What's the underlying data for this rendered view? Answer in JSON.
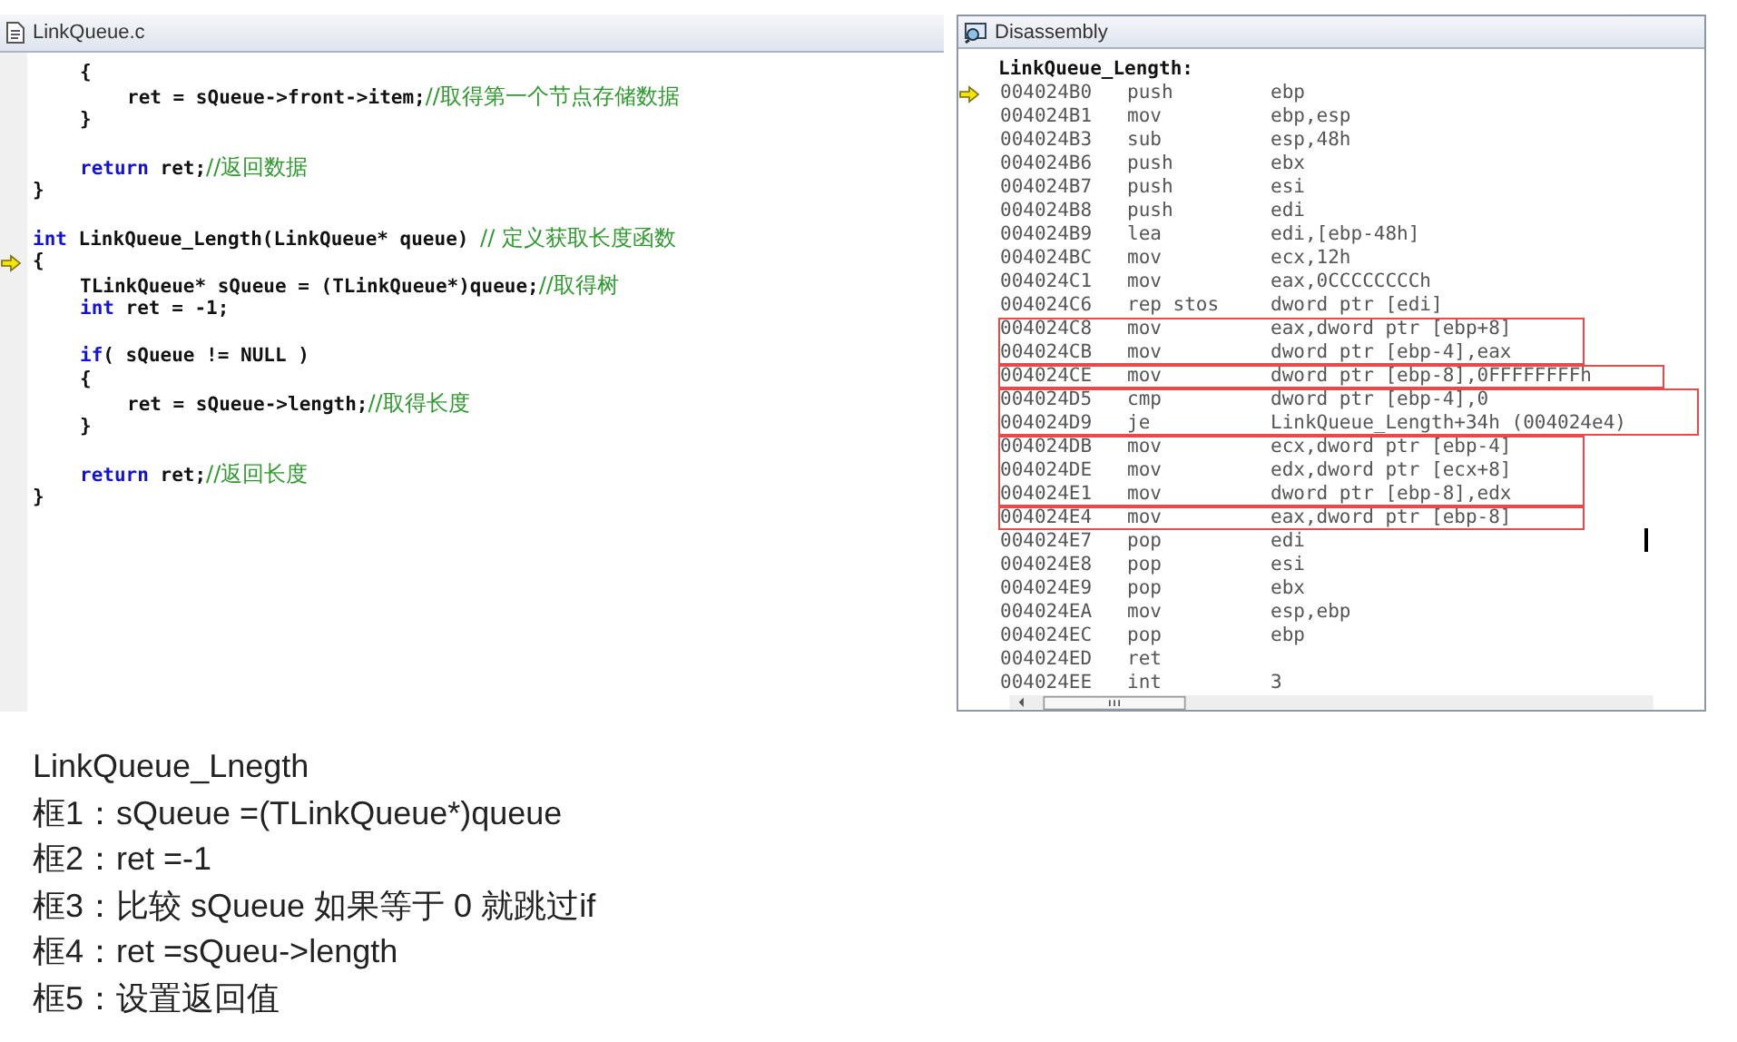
{
  "editor": {
    "title": "LinkQueue.c",
    "lines": [
      {
        "kind": "block",
        "children": [
          {
            "kind": "code",
            "current": false,
            "segments": [
              {
                "kind": "plain",
                "text": "{"
              }
            ]
          },
          {
            "kind": "block",
            "children": [
              {
                "kind": "code",
                "current": false,
                "segments": [
                  {
                    "kind": "plain",
                    "text": "ret = sQueue->front->item;"
                  },
                  {
                    "kind": "comment",
                    "text": "//取得第一个节点存储数据"
                  }
                ]
              }
            ]
          },
          {
            "kind": "code",
            "current": false,
            "segments": [
              {
                "kind": "plain",
                "text": "}"
              }
            ]
          },
          {
            "kind": "blank",
            "current": false
          },
          {
            "kind": "code",
            "current": false,
            "segments": [
              {
                "kind": "keyword",
                "text": "return"
              },
              {
                "kind": "plain",
                "text": " ret;"
              },
              {
                "kind": "comment",
                "text": "//返回数据"
              }
            ]
          }
        ]
      },
      {
        "kind": "code",
        "current": false,
        "segments": [
          {
            "kind": "plain",
            "text": "}"
          }
        ]
      },
      {
        "kind": "blank",
        "current": false
      },
      {
        "kind": "code",
        "current": false,
        "segments": [
          {
            "kind": "keyword",
            "text": "int"
          },
          {
            "kind": "plain",
            "text": " LinkQueue_Length(LinkQueue* queue) "
          },
          {
            "kind": "comment",
            "text": "// 定义获取长度函数"
          }
        ]
      },
      {
        "kind": "code",
        "current": true,
        "segments": [
          {
            "kind": "plain",
            "text": "{"
          }
        ]
      },
      {
        "kind": "block",
        "children": [
          {
            "kind": "code",
            "current": false,
            "segments": [
              {
                "kind": "plain",
                "text": "TLinkQueue* sQueue = (TLinkQueue*)queue;"
              },
              {
                "kind": "comment",
                "text": "//取得树"
              }
            ]
          },
          {
            "kind": "code",
            "current": false,
            "segments": [
              {
                "kind": "keyword",
                "text": "int"
              },
              {
                "kind": "plain",
                "text": " ret = -1;"
              }
            ]
          },
          {
            "kind": "blank",
            "current": false
          },
          {
            "kind": "code",
            "current": false,
            "segments": [
              {
                "kind": "keyword",
                "text": "if"
              },
              {
                "kind": "plain",
                "text": "( sQueue != NULL )"
              }
            ]
          },
          {
            "kind": "code",
            "current": false,
            "segments": [
              {
                "kind": "plain",
                "text": "{"
              }
            ]
          },
          {
            "kind": "block",
            "children": [
              {
                "kind": "code",
                "current": false,
                "segments": [
                  {
                    "kind": "plain",
                    "text": "ret = sQueue->length;"
                  },
                  {
                    "kind": "comment",
                    "text": "//取得长度"
                  }
                ]
              }
            ]
          },
          {
            "kind": "code",
            "current": false,
            "segments": [
              {
                "kind": "plain",
                "text": "}"
              }
            ]
          },
          {
            "kind": "blank",
            "current": false
          },
          {
            "kind": "code",
            "current": false,
            "segments": [
              {
                "kind": "keyword",
                "text": "return"
              },
              {
                "kind": "plain",
                "text": " ret;"
              },
              {
                "kind": "comment",
                "text": "//返回长度"
              }
            ]
          }
        ]
      },
      {
        "kind": "code",
        "current": false,
        "segments": [
          {
            "kind": "plain",
            "text": "}"
          }
        ]
      }
    ]
  },
  "disassembly": {
    "title": "Disassembly",
    "label": "LinkQueue_Length:",
    "rows": [
      {
        "kind": "row",
        "current": true,
        "address": "004024B0",
        "op": "push",
        "operand": "ebp"
      },
      {
        "kind": "row",
        "current": false,
        "address": "004024B1",
        "op": "mov",
        "operand": "ebp,esp"
      },
      {
        "kind": "row",
        "current": false,
        "address": "004024B3",
        "op": "sub",
        "operand": "esp,48h"
      },
      {
        "kind": "row",
        "current": false,
        "address": "004024B6",
        "op": "push",
        "operand": "ebx"
      },
      {
        "kind": "row",
        "current": false,
        "address": "004024B7",
        "op": "push",
        "operand": "esi"
      },
      {
        "kind": "row",
        "current": false,
        "address": "004024B8",
        "op": "push",
        "operand": "edi"
      },
      {
        "kind": "row",
        "current": false,
        "address": "004024B9",
        "op": "lea",
        "operand": "edi,[ebp-48h]"
      },
      {
        "kind": "row",
        "current": false,
        "address": "004024BC",
        "op": "mov",
        "operand": "ecx,12h"
      },
      {
        "kind": "row",
        "current": false,
        "address": "004024C1",
        "op": "mov",
        "operand": "eax,0CCCCCCCCh"
      },
      {
        "kind": "row",
        "current": false,
        "address": "004024C6",
        "op": "rep stos",
        "operand": "dword ptr [edi]"
      },
      {
        "kind": "box",
        "rows": [
          {
            "kind": "row",
            "current": false,
            "address": "004024C8",
            "op": "mov",
            "operand": "eax,dword ptr [ebp+8]"
          },
          {
            "kind": "row",
            "current": false,
            "address": "004024CB",
            "op": "mov",
            "operand": "dword ptr [ebp-4],eax"
          }
        ]
      },
      {
        "kind": "box",
        "rows": [
          {
            "kind": "row",
            "current": false,
            "address": "004024CE",
            "op": "mov",
            "operand": "dword ptr [ebp-8],0FFFFFFFFh"
          }
        ]
      },
      {
        "kind": "box",
        "rows": [
          {
            "kind": "row",
            "current": false,
            "address": "004024D5",
            "op": "cmp",
            "operand": "dword ptr [ebp-4],0"
          },
          {
            "kind": "row",
            "current": false,
            "address": "004024D9",
            "op": "je",
            "operand": "LinkQueue_Length+34h (004024e4)"
          }
        ]
      },
      {
        "kind": "box",
        "rows": [
          {
            "kind": "row",
            "current": false,
            "address": "004024DB",
            "op": "mov",
            "operand": "ecx,dword ptr [ebp-4]"
          },
          {
            "kind": "row",
            "current": false,
            "address": "004024DE",
            "op": "mov",
            "operand": "edx,dword ptr [ecx+8]"
          },
          {
            "kind": "row",
            "current": false,
            "address": "004024E1",
            "op": "mov",
            "operand": "dword ptr [ebp-8],edx"
          }
        ]
      },
      {
        "kind": "box",
        "rows": [
          {
            "kind": "row",
            "current": false,
            "address": "004024E4",
            "op": "mov",
            "operand": "eax,dword ptr [ebp-8]"
          }
        ]
      },
      {
        "kind": "row",
        "current": false,
        "address": "004024E7",
        "op": "pop",
        "operand": "edi"
      },
      {
        "kind": "row",
        "current": false,
        "address": "004024E8",
        "op": "pop",
        "operand": "esi"
      },
      {
        "kind": "row",
        "current": false,
        "address": "004024E9",
        "op": "pop",
        "operand": "ebx"
      },
      {
        "kind": "row",
        "current": false,
        "address": "004024EA",
        "op": "mov",
        "operand": "esp,ebp"
      },
      {
        "kind": "row",
        "current": false,
        "address": "004024EC",
        "op": "pop",
        "operand": "ebp"
      },
      {
        "kind": "row",
        "current": false,
        "address": "004024ED",
        "op": "ret"
      },
      {
        "kind": "row",
        "current": false,
        "address": "004024EE",
        "op": "int",
        "operand": "3"
      }
    ]
  },
  "notes": [
    "LinkQueue_Lnegth",
    "框1：sQueue =(TLinkQueue*)queue",
    "框2：ret =-1",
    "框3：比较 sQueue 如果等于 0 就跳过if",
    "框4：ret =sQueu->length",
    "框5：设置返回值"
  ]
}
